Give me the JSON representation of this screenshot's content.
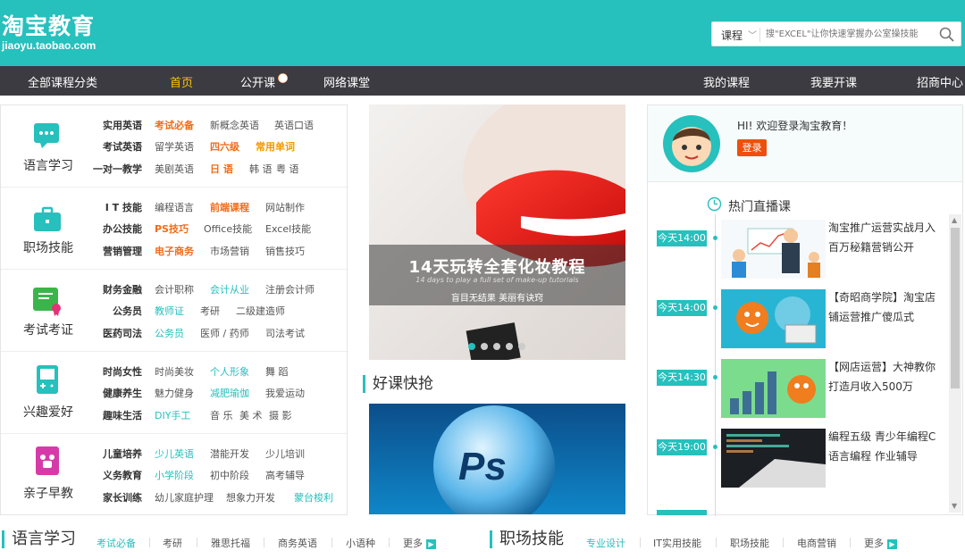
{
  "header": {
    "logo_main": "淘宝教育",
    "logo_url": "jiaoyu.taobao.com",
    "search_select": "课程",
    "search_placeholder": "搜\"EXCEL\"让你快速掌握办公室操技能"
  },
  "nav": {
    "all_categories": "全部课程分类",
    "items": [
      "首页",
      "公开课",
      "网络课堂"
    ],
    "right_items": [
      "我的课程",
      "我要开课",
      "招商中心"
    ]
  },
  "categories": [
    {
      "title": "语言学习",
      "icon": "chat-bubble-icon",
      "rows": [
        [
          "实用英语",
          "考试必备",
          "新概念英语",
          "英语口语"
        ],
        [
          "考试英语",
          "留学英语",
          "四六级",
          "常用单词"
        ],
        [
          "一对一教学",
          "美剧英语",
          "日 语",
          "韩 语",
          "粤 语"
        ]
      ]
    },
    {
      "title": "职场技能",
      "icon": "briefcase-icon",
      "rows": [
        [
          "I T 技能",
          "编程语言",
          "前端课程",
          "网站制作"
        ],
        [
          "办公技能",
          "PS技巧",
          "Office技能",
          "Excel技能"
        ],
        [
          "营销管理",
          "电子商务",
          "市场营销",
          "销售技巧"
        ]
      ]
    },
    {
      "title": "考试考证",
      "icon": "certificate-icon",
      "rows": [
        [
          "财务金融",
          "会计职称",
          "会计从业",
          "注册会计师"
        ],
        [
          "公务员",
          "教师证",
          "考研",
          "二级建造师"
        ],
        [
          "医药司法",
          "公务员",
          "医师 / 药师",
          "司法考试"
        ]
      ]
    },
    {
      "title": "兴趣爱好",
      "icon": "gamepad-icon",
      "rows": [
        [
          "时尚女性",
          "时尚美妆",
          "个人形象",
          "舞 蹈"
        ],
        [
          "健康养生",
          "魅力健身",
          "减肥瑜伽",
          "我爱运动"
        ],
        [
          "趣味生活",
          "DIY手工",
          "音 乐",
          "美 术",
          "摄 影"
        ]
      ]
    },
    {
      "title": "亲子早教",
      "icon": "toy-icon",
      "rows": [
        [
          "儿童培养",
          "少儿英语",
          "潜能开发",
          "少儿培训"
        ],
        [
          "义务教育",
          "小学阶段",
          "初中阶段",
          "高考辅导"
        ],
        [
          "家长训练",
          "幼儿家庭护理",
          "想象力开发",
          "蒙台梭利"
        ]
      ]
    }
  ],
  "banner": {
    "title": "14天玩转全套化妆教程",
    "subtitle_en": "14 days to play a full set of make-up tutorials",
    "tagline": "盲目无结果 美丽有诀窍"
  },
  "section_hot": {
    "title": "好课快抢"
  },
  "user": {
    "greeting": "HI! 欢迎登录淘宝教育！",
    "login_label": "登录"
  },
  "live": {
    "title": "热门直播课",
    "items": [
      {
        "time": "今天14:00",
        "text": "淘宝推广运营实战月入百万秘籍营销公开"
      },
      {
        "time": "今天14:00",
        "text": "【奇昭商学院】淘宝店铺运营推广傻瓜式"
      },
      {
        "time": "今天14:30",
        "text": "【网店运营】大神教你打造月收入500万"
      },
      {
        "time": "今天19:00",
        "text": "编程五级 青少年编程C语言编程 作业辅导"
      }
    ]
  },
  "bottom": {
    "left_title": "语言学习",
    "left_links": [
      "考试必备",
      "考研",
      "雅思托福",
      "商务英语",
      "小语种",
      "更多"
    ],
    "right_title": "职场技能",
    "right_links": [
      "专业设计",
      "IT实用技能",
      "职场技能",
      "电商营销",
      "更多"
    ]
  },
  "colors": {
    "accent": "#26c0bd",
    "nav_bg": "#3b3b41",
    "highlight": "#f06c1a",
    "active_nav": "#fdc600"
  }
}
